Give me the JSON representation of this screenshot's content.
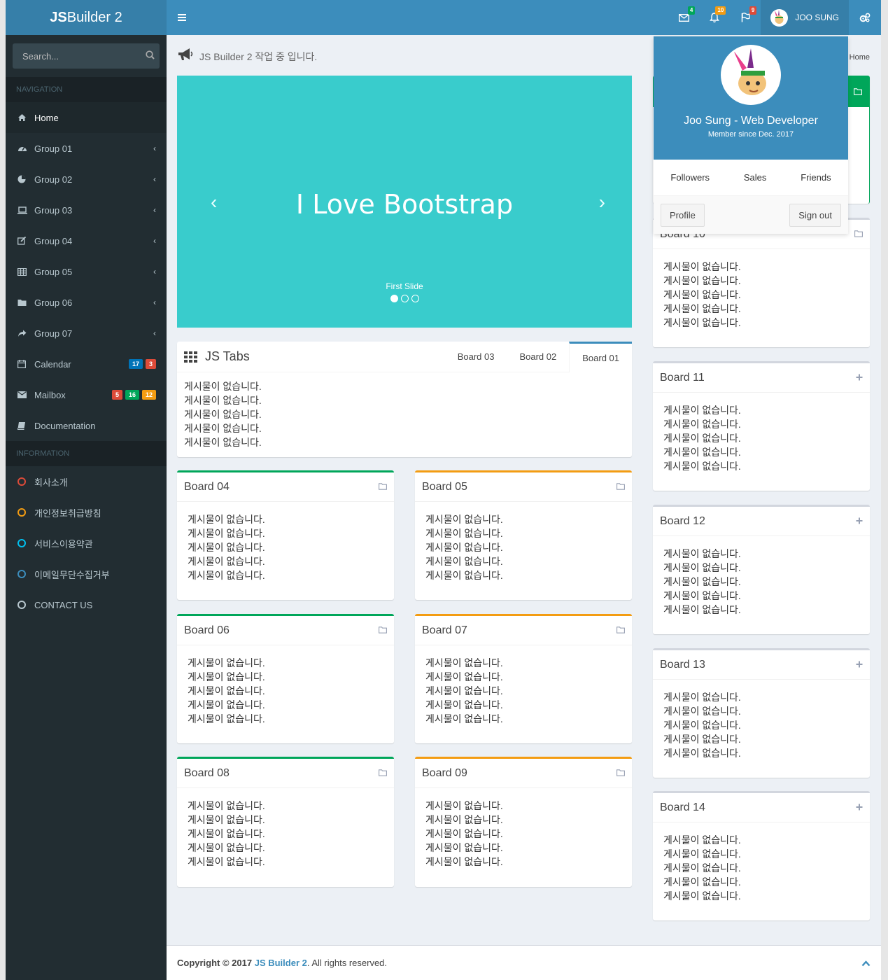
{
  "app": {
    "logo_bold": "JS",
    "logo_rest": "Builder 2"
  },
  "navbar": {
    "messages_count": "4",
    "notifications_count": "10",
    "flags_count": "9",
    "user_name": "JOO SUNG",
    "colors": {
      "messages": "#00a65a",
      "notifications": "#f39c12",
      "flags": "#dd4b39"
    }
  },
  "sidebar": {
    "search_placeholder": "Search...",
    "nav_header": "NAVIGATION",
    "items": [
      {
        "label": "Home",
        "icon": "home-icon"
      },
      {
        "label": "Group 01",
        "icon": "dashboard-icon"
      },
      {
        "label": "Group 02",
        "icon": "pie-chart-icon"
      },
      {
        "label": "Group 03",
        "icon": "laptop-icon"
      },
      {
        "label": "Group 04",
        "icon": "edit-icon"
      },
      {
        "label": "Group 05",
        "icon": "table-icon"
      },
      {
        "label": "Group 06",
        "icon": "folder-icon"
      },
      {
        "label": "Group 07",
        "icon": "share-icon"
      },
      {
        "label": "Calendar",
        "icon": "calendar-icon",
        "badges": [
          "17",
          "3"
        ]
      },
      {
        "label": "Mailbox",
        "icon": "envelope-icon",
        "badges": [
          "5",
          "16",
          "12"
        ]
      },
      {
        "label": "Documentation",
        "icon": "book-icon"
      }
    ],
    "info_header": "INFORMATION",
    "info_items": [
      {
        "label": "회사소개",
        "color": "#dd4b39"
      },
      {
        "label": "개인정보취급방침",
        "color": "#f39c12"
      },
      {
        "label": "서비스이용약관",
        "color": "#00c0ef"
      },
      {
        "label": "이메일무단수집거부",
        "color": "#3c8dbc"
      },
      {
        "label": "CONTACT US",
        "color": "#b8c7ce"
      }
    ]
  },
  "page": {
    "heading": "JS Builder 2 작업 중 입니다.",
    "breadcrumb": "Home"
  },
  "carousel": {
    "title": "I Love Bootstrap",
    "caption": "First Slide",
    "active_index": 0,
    "slides": 3
  },
  "tabs_box": {
    "title": "JS Tabs",
    "tabs": [
      "Board 03",
      "Board 02",
      "Board 01"
    ],
    "active": "Board 01",
    "lines": [
      "게시물이 없습니다.",
      "게시물이 없습니다.",
      "게시물이 없습니다.",
      "게시물이 없습니다.",
      "게시물이 없습니다."
    ]
  },
  "boards": {
    "b04": "Board 04",
    "b05": "Board 05",
    "b06": "Board 06",
    "b07": "Board 07",
    "b08": "Board 08",
    "b09": "Board 09",
    "b10": "Board 10",
    "b11": "Board 11",
    "b12": "Board 12",
    "b13": "Board 13",
    "b14": "Board 14",
    "empty": "게시물이 없습니다."
  },
  "user_dropdown": {
    "name": "Joo Sung - Web Developer",
    "since": "Member since Dec. 2017",
    "links": [
      "Followers",
      "Sales",
      "Friends"
    ],
    "profile": "Profile",
    "signout": "Sign out"
  },
  "footer": {
    "prefix": "Copyright © 2017 ",
    "link": "JS Builder 2",
    "suffix": ". All rights reserved."
  }
}
